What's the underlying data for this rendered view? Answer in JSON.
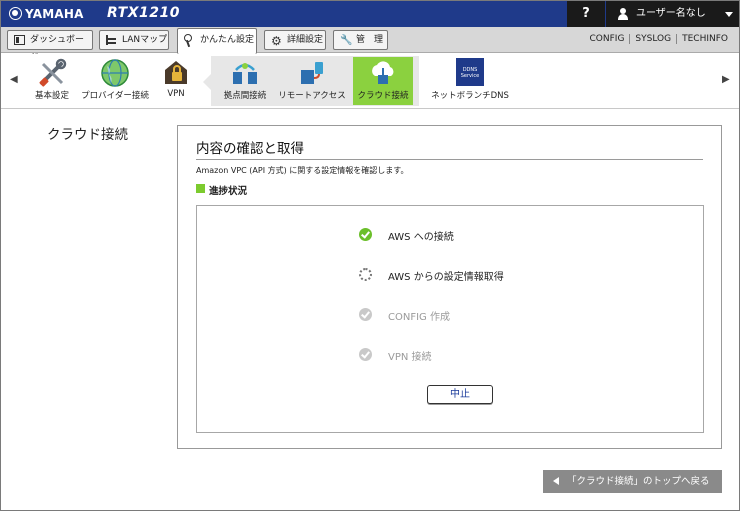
{
  "header": {
    "brand": "YAMAHA",
    "model": "RTX1210",
    "help_label": "?",
    "user_label": "ユーザー名なし"
  },
  "tabs": [
    {
      "label": "ダッシュボード",
      "icon": "dashboard-icon"
    },
    {
      "label": "LANマップ",
      "icon": "lan-map-icon"
    },
    {
      "label": "かんたん設定",
      "icon": "easy-setup-icon",
      "active": true
    },
    {
      "label": "詳細設定",
      "icon": "gear-icon"
    },
    {
      "label": "管　理",
      "icon": "wrench-icon"
    }
  ],
  "top_links": [
    "CONFIG",
    "SYSLOG",
    "TECHINFO"
  ],
  "nav": {
    "items": [
      {
        "label": "基本設定",
        "icon": "tools-icon"
      },
      {
        "label": "プロバイダー接続",
        "icon": "globe-icon"
      },
      {
        "label": "VPN",
        "icon": "vpn-lock-icon"
      },
      {
        "label": "拠点間接続",
        "icon": "site-to-site-icon"
      },
      {
        "label": "リモートアクセス",
        "icon": "remote-access-icon"
      },
      {
        "label": "クラウド接続",
        "icon": "cloud-connect-icon",
        "selected": true
      },
      {
        "label": "ネットボランチDNS",
        "icon": "ddns-service-icon"
      }
    ],
    "ddns_badge": [
      "DDNS",
      "Service"
    ]
  },
  "page": {
    "side_title": "クラウド接続",
    "panel_title": "内容の確認と取得",
    "description": "Amazon VPC (API 方式) に関する設定情報を確認します。",
    "section_heading": "進捗状況",
    "steps": [
      {
        "label": "AWS への接続",
        "status": "done"
      },
      {
        "label": "AWS からの設定情報取得",
        "status": "in-progress"
      },
      {
        "label": "CONFIG 作成",
        "status": "pending"
      },
      {
        "label": "VPN 接続",
        "status": "pending"
      }
    ],
    "cancel_label": "中止",
    "back_label": "「クラウド接続」のトップへ戻る"
  },
  "colors": {
    "header_blue": "#1f3a8a",
    "accent_green": "#8bd13f",
    "done_green": "#6bbf2a",
    "pending_gray": "#c9c9c9"
  }
}
